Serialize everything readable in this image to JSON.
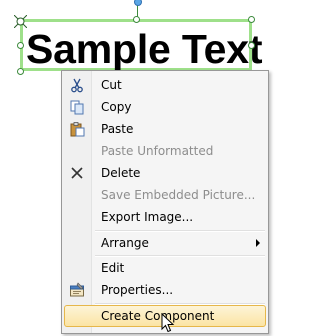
{
  "canvas": {
    "text_object": "Sample Text"
  },
  "context_menu": {
    "items": [
      {
        "label": "Cut",
        "icon": "scissors-icon",
        "enabled": true
      },
      {
        "label": "Copy",
        "icon": "copy-icon",
        "enabled": true
      },
      {
        "label": "Paste",
        "icon": "paste-icon",
        "enabled": true
      },
      {
        "label": "Paste Unformatted",
        "icon": "",
        "enabled": false
      },
      {
        "label": "Delete",
        "icon": "delete-x-icon",
        "enabled": true
      },
      {
        "label": "Save Embedded Picture...",
        "icon": "",
        "enabled": false
      },
      {
        "label": "Export Image...",
        "icon": "",
        "enabled": true
      },
      {
        "label": "Arrange",
        "icon": "",
        "enabled": true,
        "submenu": true
      },
      {
        "label": "Edit",
        "icon": "",
        "enabled": true
      },
      {
        "label": "Properties...",
        "icon": "properties-icon",
        "enabled": true
      },
      {
        "label": "Create Component",
        "icon": "",
        "enabled": true,
        "highlighted": true
      }
    ]
  },
  "colors": {
    "selection_border": "#9ee08a",
    "handle_border": "#3d8a3d",
    "rotate_handle": "#5aa6e6",
    "menu_highlight": "#fbe4a4",
    "disabled_text": "#8d8d8d"
  }
}
